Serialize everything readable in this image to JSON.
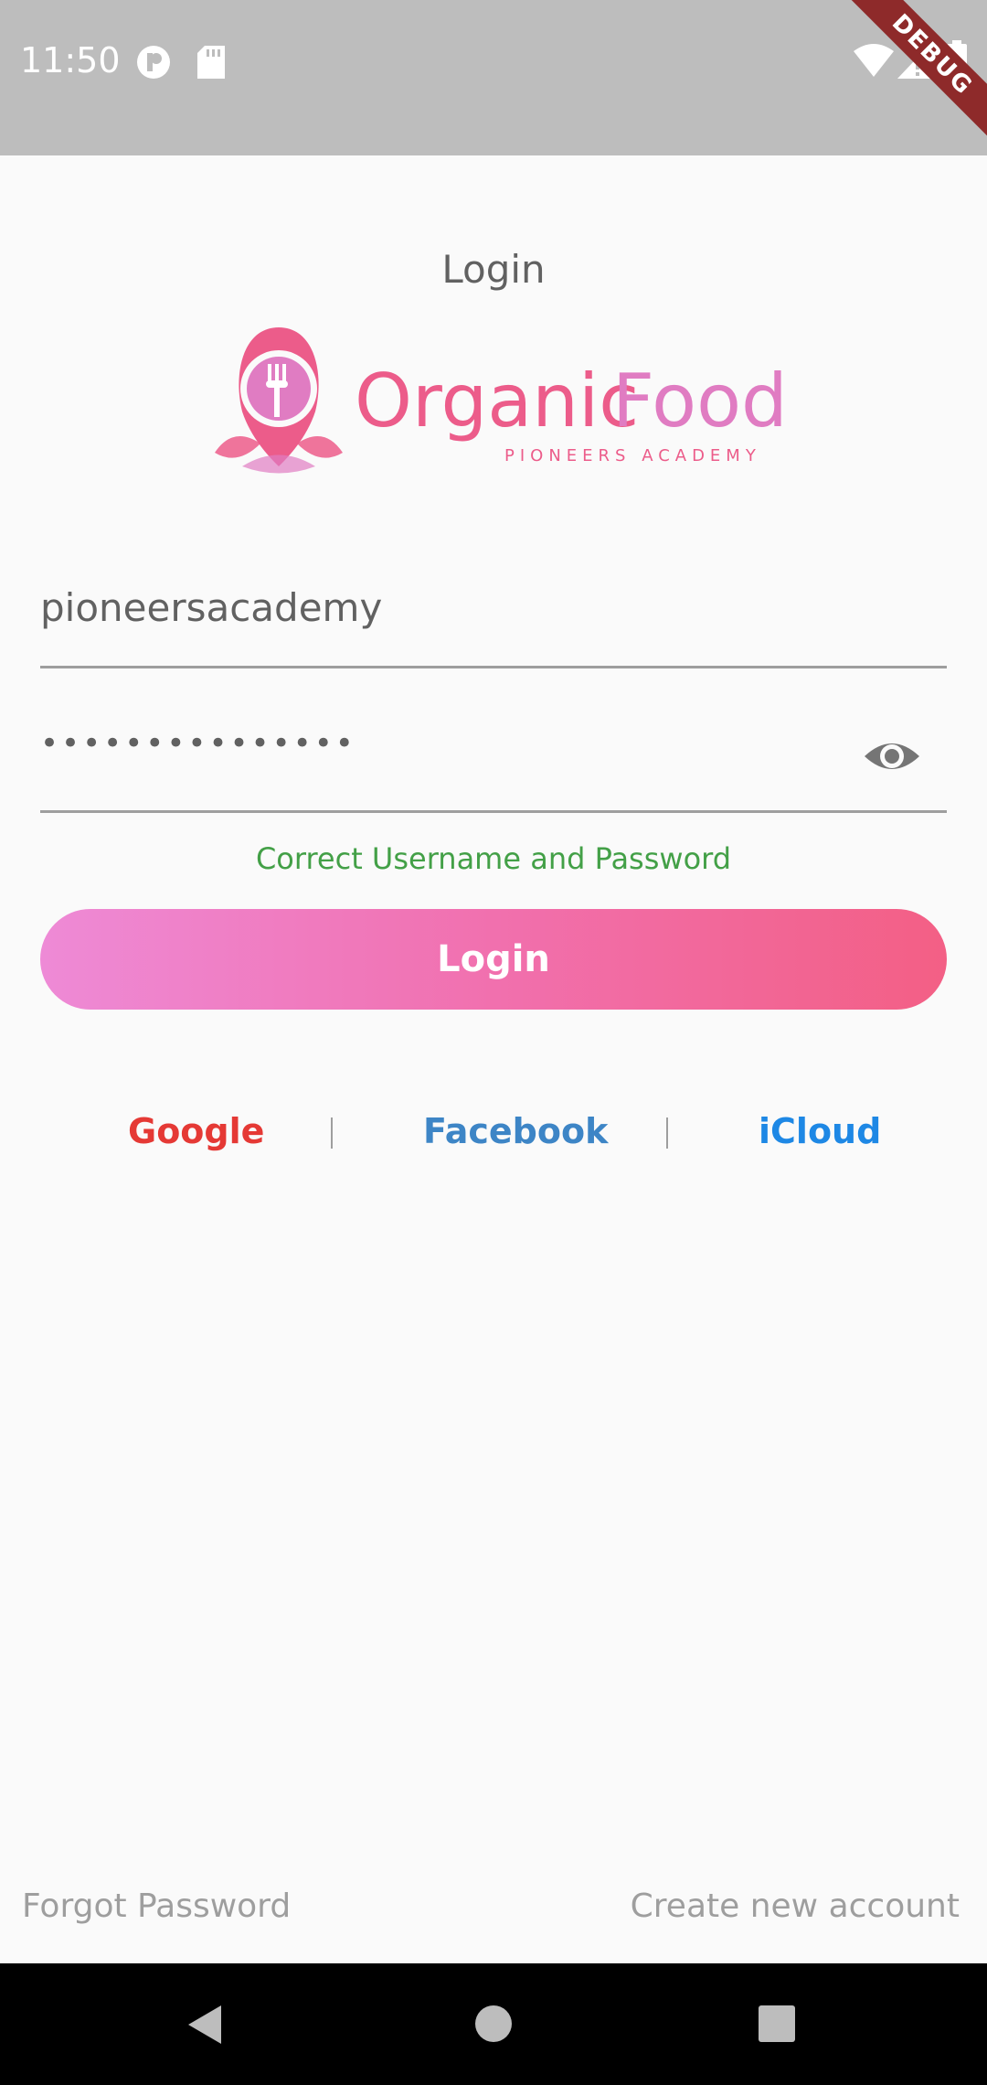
{
  "status_bar": {
    "time": "11:50",
    "debug_label": "DEBUG",
    "icons": [
      "circle-p-icon",
      "sd-card-icon",
      "wifi-icon",
      "signal-icon",
      "battery-icon"
    ]
  },
  "page": {
    "title": "Login"
  },
  "logo": {
    "brand_part1": "Organic",
    "brand_part2": "Food",
    "tagline": "PIONEERS ACADEMY",
    "colors": {
      "primary": "#EC5C8A",
      "secondary": "#E07CC2"
    }
  },
  "form": {
    "username_value": "pioneersacademy",
    "password_value": "•••••••••••••••",
    "password_toggle_icon": "eye-icon",
    "status_message": "Correct Username and Password",
    "status_color": "#43A047",
    "login_button_label": "Login"
  },
  "social": {
    "items": [
      {
        "label": "Google",
        "color": "#E53935"
      },
      {
        "label": "Facebook",
        "color": "#3D85C6"
      },
      {
        "label": "iCloud",
        "color": "#1E88E5"
      }
    ]
  },
  "footer": {
    "forgot_password": "Forgot Password",
    "create_account": "Create new account"
  },
  "nav_bar": {
    "icons": [
      "back-icon",
      "home-icon",
      "recents-icon"
    ]
  }
}
